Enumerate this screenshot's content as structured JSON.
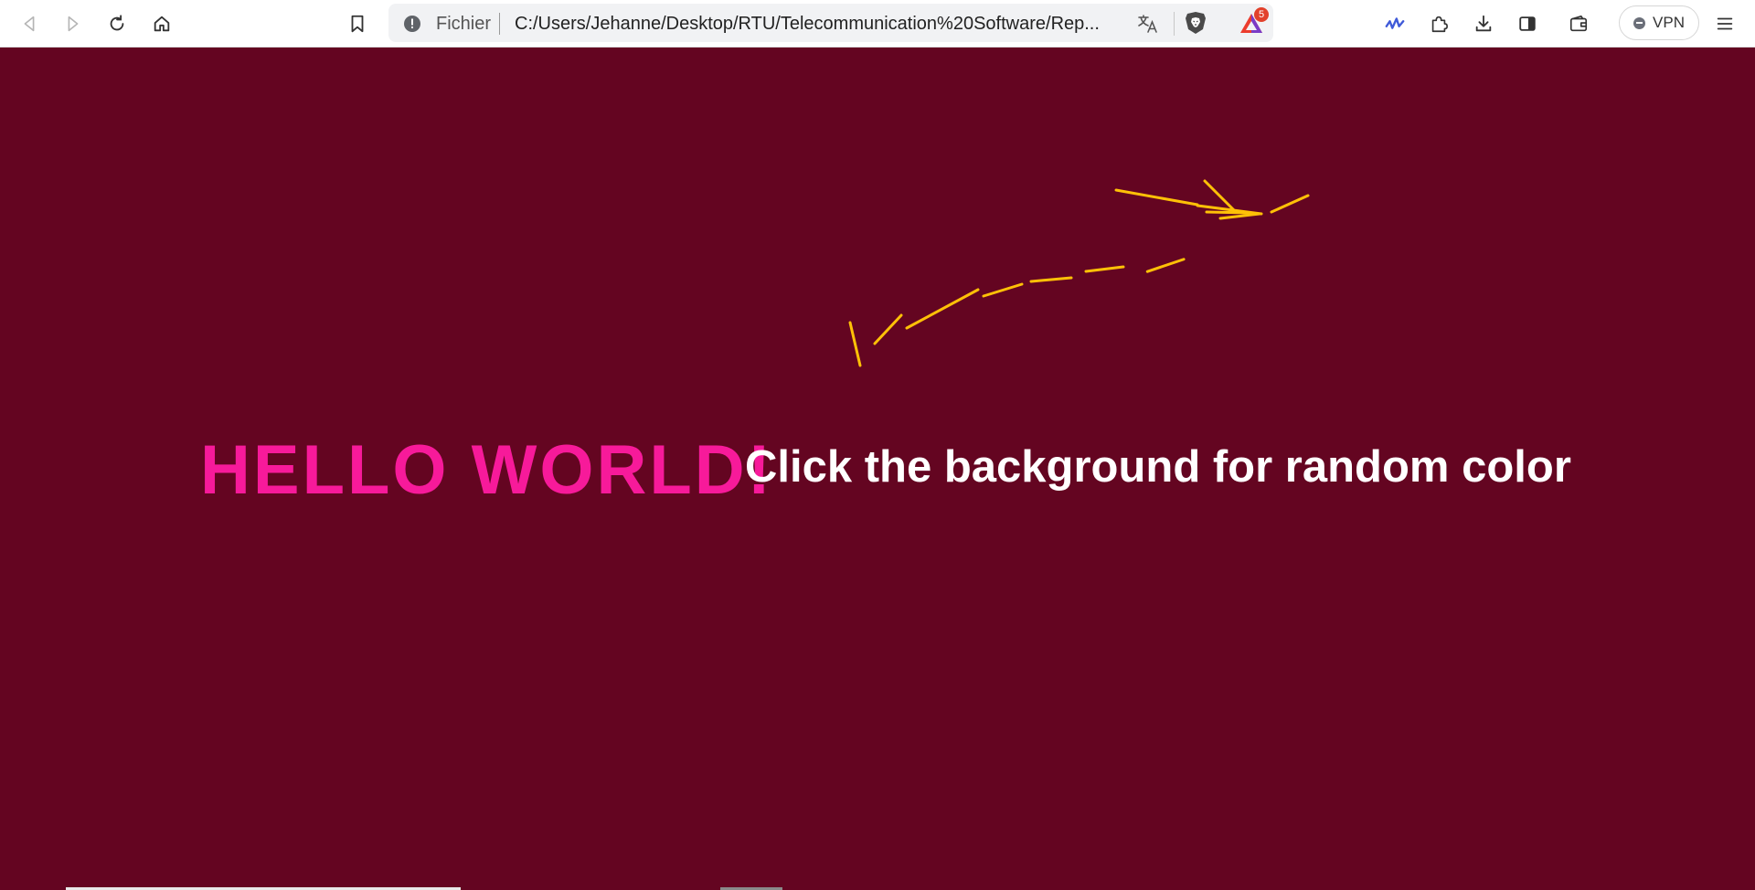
{
  "browser": {
    "url_scheme": "Fichier",
    "url": "C:/Users/Jehanne/Desktop/RTU/Telecommunication%20Software/Rep...",
    "rewards_badge": "5",
    "vpn_label": "VPN"
  },
  "page": {
    "heading": "HELLO WORLD!",
    "instruction": "Click the background for random color",
    "background_color": "#640521",
    "heading_color": "#f71a9a",
    "instruction_color": "#ffffff",
    "drawing_color": "#ffc107"
  },
  "icons": [
    "back-icon",
    "forward-icon",
    "reload-icon",
    "home-icon",
    "bookmark-icon",
    "info-icon",
    "translate-icon",
    "brave-shields-icon",
    "brave-rewards-icon",
    "brave-leo-icon",
    "extensions-icon",
    "downloads-icon",
    "sidebar-icon",
    "wallet-icon",
    "menu-icon"
  ]
}
